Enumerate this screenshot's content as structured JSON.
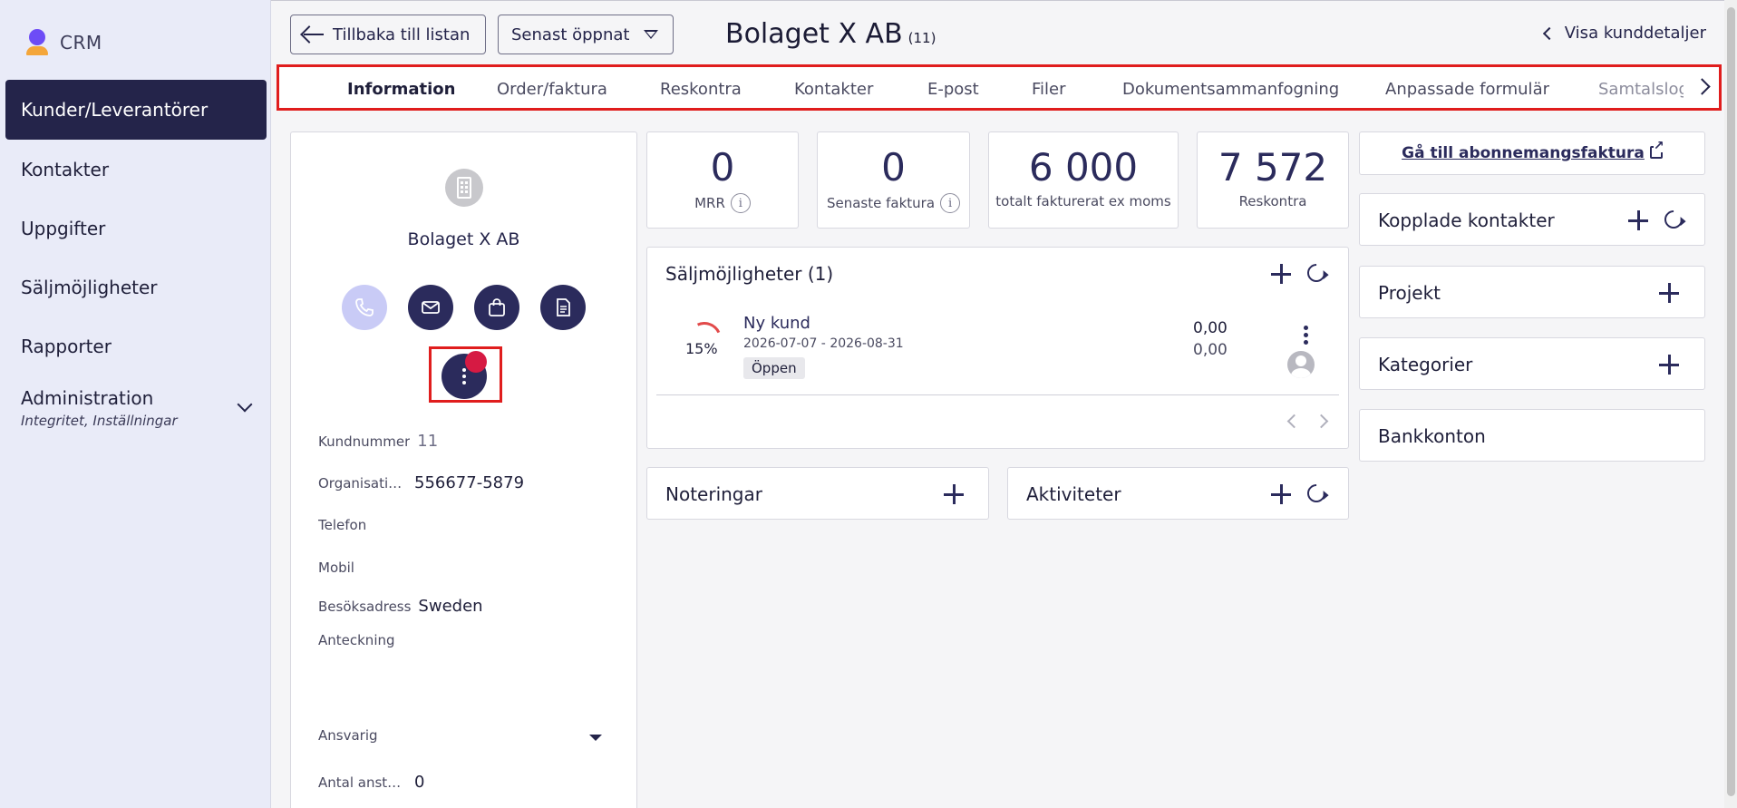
{
  "app": {
    "name": "CRM"
  },
  "sidebar": {
    "items": [
      {
        "label": "Kunder/Leverantörer",
        "active": true
      },
      {
        "label": "Kontakter"
      },
      {
        "label": "Uppgifter"
      },
      {
        "label": "Säljmöjligheter"
      },
      {
        "label": "Rapporter"
      },
      {
        "label": "Administration",
        "sub": "Integritet, Inställningar"
      }
    ]
  },
  "header": {
    "back_label": "Tillbaka till listan",
    "recent_label": "Senast öppnat",
    "title": "Bolaget X AB",
    "title_count": "(11)",
    "details_label": "Visa kunddetaljer"
  },
  "tabs": [
    "Information",
    "Order/faktura",
    "Reskontra",
    "Kontakter",
    "E-post",
    "Filer",
    "Dokumentsammanfogning",
    "Anpassade formulär",
    "Samtalslogg"
  ],
  "profile": {
    "company_name": "Bolaget X AB",
    "fields": {
      "kundnummer_label": "Kundnummer",
      "kundnummer_value": "11",
      "org_label": "Organisationsnummer",
      "org_value": "556677-5879",
      "telefon_label": "Telefon",
      "mobil_label": "Mobil",
      "besok_label": "Besöksadress",
      "besok_value": "Sweden",
      "anteckning_label": "Anteckning",
      "ansvarig_label": "Ansvarig",
      "anstallda_label": "Antal anställda",
      "anstallda_value": "0"
    }
  },
  "stats": [
    {
      "value": "0",
      "label": "MRR",
      "info": true
    },
    {
      "value": "0",
      "label": "Senaste faktura",
      "info": true
    },
    {
      "value": "6 000",
      "label": "totalt fakturerat ex moms"
    },
    {
      "value": "7 572",
      "label": "Reskontra"
    }
  ],
  "sales": {
    "title": "Säljmöjligheter (1)",
    "item": {
      "progress": 0.15,
      "percent": "15%",
      "name": "Ny kund",
      "dates": "2026-07-07 - 2026-08-31",
      "status": "Öppen",
      "amount1": "0,00",
      "amount2": "0,00"
    }
  },
  "notes": {
    "title": "Noteringar"
  },
  "activities": {
    "title": "Aktiviteter"
  },
  "side": {
    "subscription_link": "Gå till abonnemangsfaktura",
    "connected_contacts": "Kopplade kontakter",
    "projects": "Projekt",
    "categories": "Kategorier",
    "bank_accounts": "Bankkonton"
  },
  "colors": {
    "accent": "#2b2b5c",
    "highlight": "#e01d1d",
    "badge": "#d61a43"
  }
}
